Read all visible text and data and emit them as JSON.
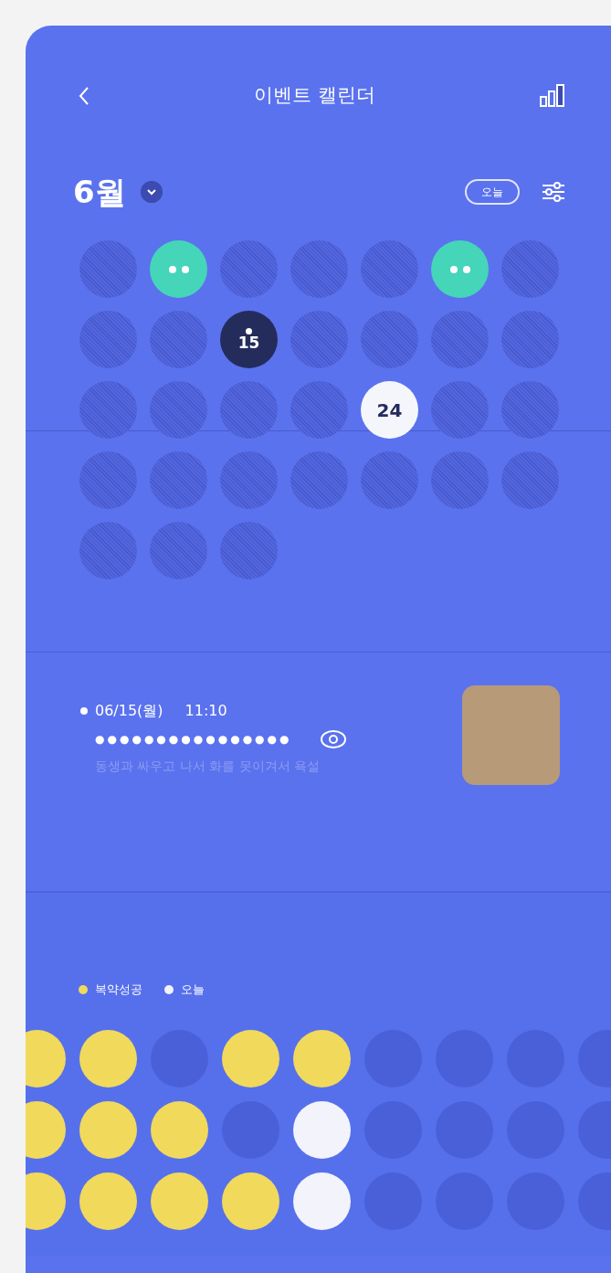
{
  "header": {
    "title": "이벤트 캘린더"
  },
  "month": {
    "label": "6월",
    "today_button": "오늘"
  },
  "calendar": [
    {
      "kind": "plain"
    },
    {
      "kind": "event"
    },
    {
      "kind": "plain"
    },
    {
      "kind": "plain"
    },
    {
      "kind": "plain"
    },
    {
      "kind": "event"
    },
    {
      "kind": "plain"
    },
    {
      "kind": "plain"
    },
    {
      "kind": "plain"
    },
    {
      "kind": "selected",
      "label": "15"
    },
    {
      "kind": "plain"
    },
    {
      "kind": "plain"
    },
    {
      "kind": "plain"
    },
    {
      "kind": "plain"
    },
    {
      "kind": "plain"
    },
    {
      "kind": "plain"
    },
    {
      "kind": "plain"
    },
    {
      "kind": "plain"
    },
    {
      "kind": "today",
      "label": "24"
    },
    {
      "kind": "plain"
    },
    {
      "kind": "plain"
    },
    {
      "kind": "plain"
    },
    {
      "kind": "plain"
    },
    {
      "kind": "plain"
    },
    {
      "kind": "plain"
    },
    {
      "kind": "plain"
    },
    {
      "kind": "plain"
    },
    {
      "kind": "plain"
    },
    {
      "kind": "plain"
    },
    {
      "kind": "plain"
    },
    {
      "kind": "plain"
    }
  ],
  "event": {
    "date": "06/15(월)",
    "time": "11:10",
    "masked_text": "●●●●●●●●●●●●●●●●",
    "description": "동생과 싸우고 나서 화를 못이겨서 욕설"
  },
  "legend": [
    {
      "label": "복약성공",
      "color": "#f1d95c"
    },
    {
      "label": "오늘",
      "color": "#f2f3fb"
    }
  ],
  "dots": [
    [
      {
        "kind": "success"
      },
      {
        "kind": "success"
      },
      {
        "kind": "none"
      },
      {
        "kind": "success"
      },
      {
        "kind": "success"
      },
      {
        "kind": "none"
      },
      {
        "kind": "none"
      },
      {
        "kind": "none"
      },
      {
        "kind": "none"
      }
    ],
    [
      {
        "kind": "success"
      },
      {
        "kind": "success"
      },
      {
        "kind": "success"
      },
      {
        "kind": "none"
      },
      {
        "kind": "today"
      },
      {
        "kind": "none"
      },
      {
        "kind": "none"
      },
      {
        "kind": "none"
      },
      {
        "kind": "none"
      }
    ],
    [
      {
        "kind": "success"
      },
      {
        "kind": "success"
      },
      {
        "kind": "success"
      },
      {
        "kind": "success"
      },
      {
        "kind": "today"
      },
      {
        "kind": "none"
      },
      {
        "kind": "none"
      },
      {
        "kind": "none"
      },
      {
        "kind": "none"
      }
    ]
  ]
}
